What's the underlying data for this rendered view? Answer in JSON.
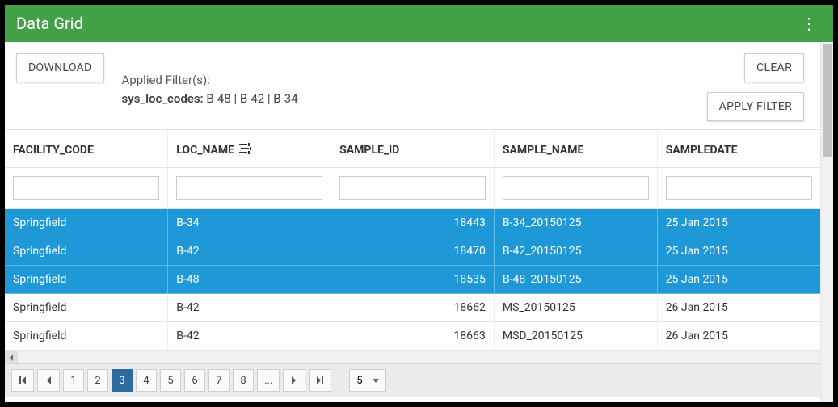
{
  "header": {
    "title": "Data Grid"
  },
  "buttons": {
    "download": "DOWNLOAD",
    "clear": "CLEAR",
    "apply_filter": "APPLY FILTER"
  },
  "applied_filters": {
    "heading": "Applied Filter(s):",
    "label": "sys_loc_codes:",
    "value": "B-48 | B-42 | B-34"
  },
  "columns": {
    "facility_code": "FACILITY_CODE",
    "loc_name": "LOC_NAME",
    "sample_id": "SAMPLE_ID",
    "sample_name": "SAMPLE_NAME",
    "sampledate": "SAMPLEDATE"
  },
  "rows": [
    {
      "selected": true,
      "facility_code": "Springfield",
      "loc_name": "B-34",
      "sample_id": "18443",
      "sample_name": "B-34_20150125",
      "sampledate": "25 Jan 2015"
    },
    {
      "selected": true,
      "facility_code": "Springfield",
      "loc_name": "B-42",
      "sample_id": "18470",
      "sample_name": "B-42_20150125",
      "sampledate": "25 Jan 2015"
    },
    {
      "selected": true,
      "facility_code": "Springfield",
      "loc_name": "B-48",
      "sample_id": "18535",
      "sample_name": "B-48_20150125",
      "sampledate": "25 Jan 2015"
    },
    {
      "selected": false,
      "facility_code": "Springfield",
      "loc_name": "B-42",
      "sample_id": "18662",
      "sample_name": "MS_20150125",
      "sampledate": "26 Jan 2015"
    },
    {
      "selected": false,
      "facility_code": "Springfield",
      "loc_name": "B-42",
      "sample_id": "18663",
      "sample_name": "MSD_20150125",
      "sampledate": "26 Jan 2015"
    }
  ],
  "pager": {
    "pages": [
      "1",
      "2",
      "3",
      "4",
      "5",
      "6",
      "7",
      "8",
      "..."
    ],
    "current": "3",
    "page_size": "5"
  }
}
